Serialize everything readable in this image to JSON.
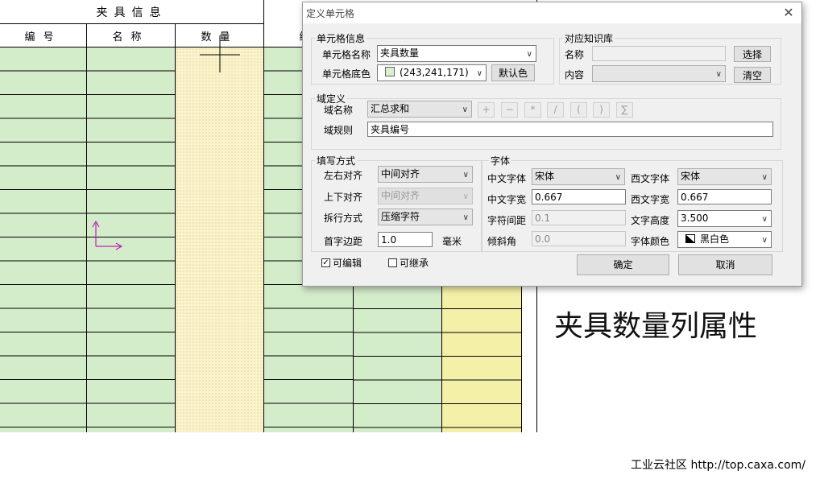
{
  "sheet": {
    "group_header": "夹具信息",
    "columns": [
      "编号",
      "名称",
      "数量",
      "编"
    ],
    "colors": {
      "green": "#d3ecc9",
      "yellow": "#f5f0a8"
    }
  },
  "dialog": {
    "title": "定义单元格",
    "cell_info": {
      "legend": "单元格信息",
      "name_label": "单元格名称",
      "name_value": "夹具数量",
      "color_label": "单元格底色",
      "color_value": "(243,241,171)",
      "swatch_color": "#d8efd0",
      "default_color_button": "默认色"
    },
    "knowledge": {
      "legend": "对应知识库",
      "name_label": "名称",
      "name_value": "",
      "content_label": "内容",
      "content_value": "",
      "select_button": "选择",
      "clear_button": "清空"
    },
    "domain": {
      "legend": "域定义",
      "name_label": "域名称",
      "name_value": "汇总求和",
      "rule_label": "域规则",
      "rule_value": "夹具编号",
      "operators": [
        "+",
        "−",
        "*",
        "/",
        "(",
        ")",
        "∑"
      ]
    },
    "fill": {
      "legend": "填写方式",
      "h_align_label": "左右对齐",
      "h_align_value": "中间对齐",
      "v_align_label": "上下对齐",
      "v_align_value": "中间对齐",
      "wrap_label": "拆行方式",
      "wrap_value": "压缩字符",
      "margin_label": "首字边距",
      "margin_value": "1.0",
      "margin_unit": "毫米"
    },
    "font": {
      "legend": "字体",
      "cn_font_label": "中文字体",
      "cn_font_value": "宋体",
      "cn_width_label": "中文字宽",
      "cn_width_value": "0.667",
      "spacing_label": "字符间距",
      "spacing_value": "0.1",
      "slant_label": "倾斜角",
      "slant_value": "0.0",
      "west_font_label": "西文字体",
      "west_font_value": "宋体",
      "west_width_label": "西文字宽",
      "west_width_value": "0.667",
      "height_label": "文字高度",
      "height_value": "3.500",
      "color_label": "字体颜色",
      "color_value": "黑白色"
    },
    "editable_label": "可编辑",
    "editable_checked": "✓",
    "inherit_label": "可继承",
    "ok_button": "确定",
    "cancel_button": "取消"
  },
  "caption": "夹具数量列属性",
  "footer": "工业云社区 http://top.caxa.com/"
}
